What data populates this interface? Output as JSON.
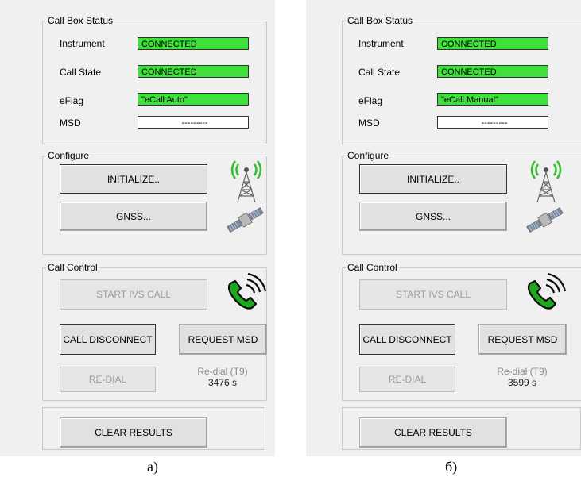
{
  "panels": [
    {
      "status": {
        "title": "Call Box Status",
        "instrument_label": "Instrument",
        "instrument_value": "CONNECTED",
        "callstate_label": "Call State",
        "callstate_value": "CONNECTED",
        "eflag_label": "eFlag",
        "eflag_value": "\"eCall Auto\"",
        "msd_label": "MSD",
        "msd_value": "---------"
      },
      "configure": {
        "title": "Configure",
        "initialize": "INITIALIZE..",
        "gnss": "GNSS..."
      },
      "call_control": {
        "title": "Call Control",
        "start": "START IVS CALL",
        "disconnect": "CALL DISCONNECT",
        "request_msd": "REQUEST MSD",
        "redial": "RE-DIAL",
        "redial_timer_label": "Re-dial (T9)",
        "redial_timer_value": "3476 s"
      },
      "clear": "CLEAR RESULTS",
      "caption": "а)"
    },
    {
      "status": {
        "title": "Call Box Status",
        "instrument_label": "Instrument",
        "instrument_value": "CONNECTED",
        "callstate_label": "Call State",
        "callstate_value": "CONNECTED",
        "eflag_label": "eFlag",
        "eflag_value": "\"eCall Manual\"",
        "msd_label": "MSD",
        "msd_value": "---------"
      },
      "configure": {
        "title": "Configure",
        "initialize": "INITIALIZE..",
        "gnss": "GNSS..."
      },
      "call_control": {
        "title": "Call Control",
        "start": "START IVS CALL",
        "disconnect": "CALL DISCONNECT",
        "request_msd": "REQUEST MSD",
        "redial": "RE-DIAL",
        "redial_timer_label": "Re-dial (T9)",
        "redial_timer_value": "3599 s"
      },
      "clear": "CLEAR RESULTS",
      "caption": "б)"
    }
  ],
  "colors": {
    "connected_green": "#3ee03b",
    "phone_green": "#1ea81e",
    "panel_bg": "#f0f0f0"
  },
  "icons": {
    "antenna": "radio-tower-icon",
    "satellite": "satellite-icon",
    "phone": "phone-ringing-icon"
  }
}
